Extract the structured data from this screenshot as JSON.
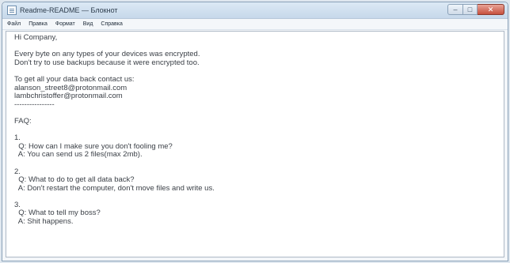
{
  "window": {
    "title": "Readme-README — Блокнот",
    "caption_buttons": {
      "minimize": "–",
      "maximize": "□",
      "close": "✕"
    }
  },
  "menu": {
    "items": [
      "Файл",
      "Правка",
      "Формат",
      "Вид",
      "Справка"
    ]
  },
  "document": {
    "lines": [
      "Hi Company,",
      "",
      "Every byte on any types of your devices was encrypted.",
      "Don't try to use backups because it were encrypted too.",
      "",
      "To get all your data back contact us:",
      "alanson_street8@protonmail.com",
      "lambchristoffer@protonmail.com",
      "----------------",
      "",
      "FAQ:",
      "",
      "1.",
      "  Q: How can I make sure you don't fooling me?",
      "  A: You can send us 2 files(max 2mb).",
      "",
      "2.",
      "  Q: What to do to get all data back?",
      "  A: Don't restart the computer, don't move files and write us.",
      "",
      "3.",
      "  Q: What to tell my boss?",
      "  A: Shit happens."
    ]
  }
}
